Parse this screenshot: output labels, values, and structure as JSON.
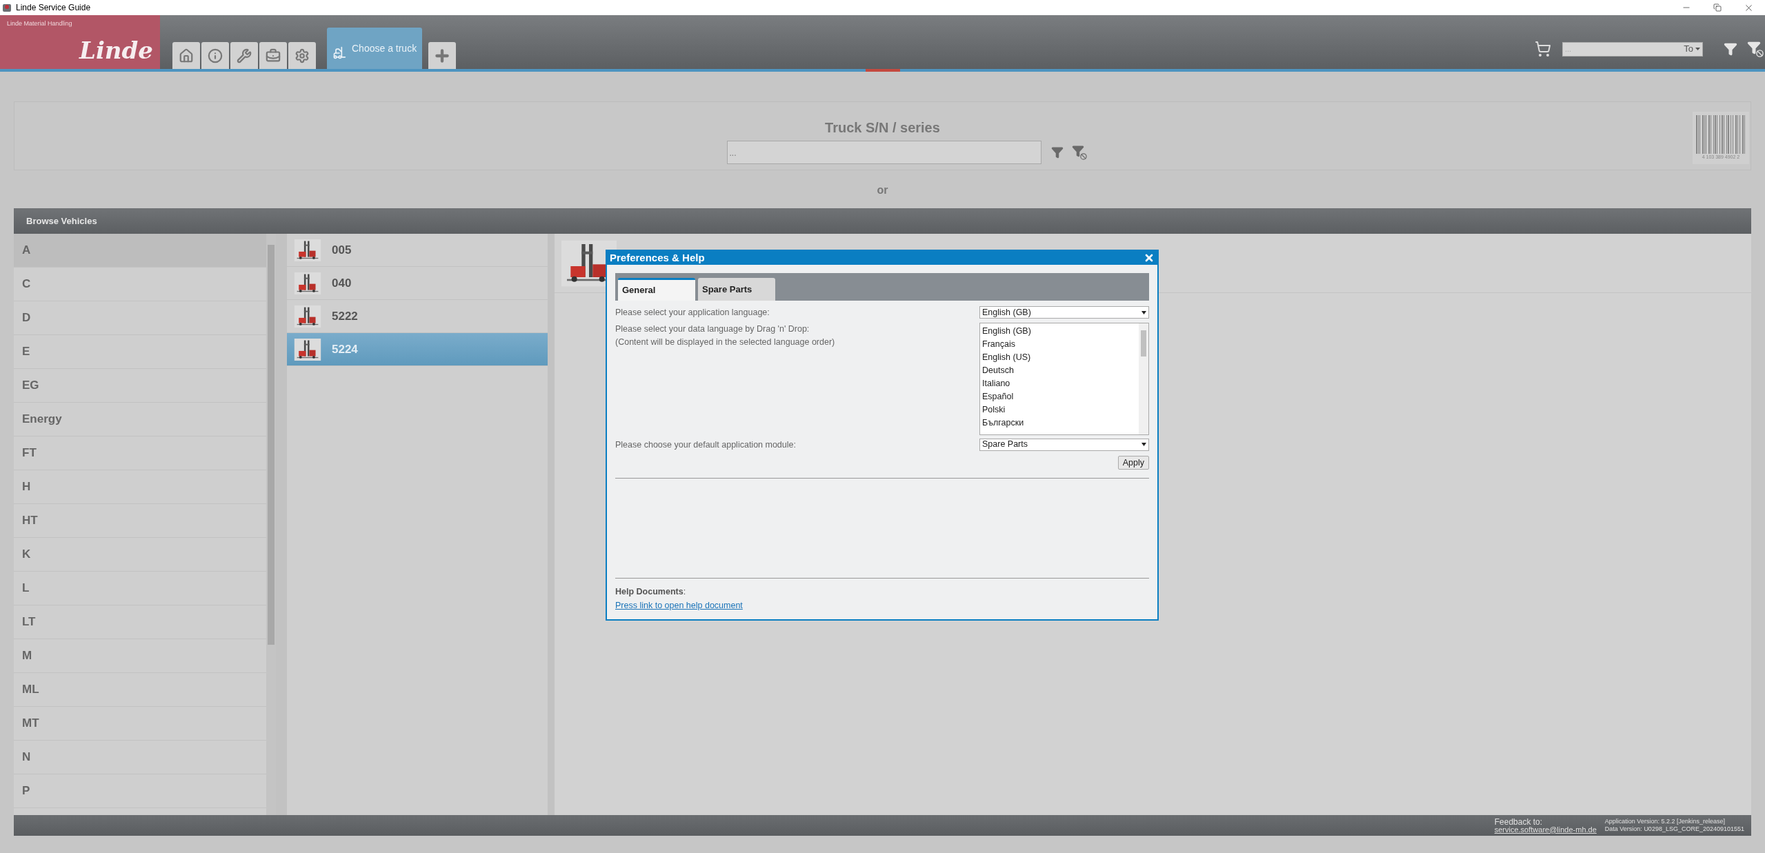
{
  "window": {
    "title": "Linde Service Guide"
  },
  "header": {
    "brand": "Linde Material Handling",
    "logo": "Linde",
    "tabs": [
      {
        "label": "Choose a truck",
        "selected": true
      }
    ],
    "search": {
      "placeholder": "...",
      "dropdown": "To"
    }
  },
  "search": {
    "title": "Truck S/N / series",
    "placeholder": "...",
    "barcode_digits": "4 103 389 4902 2"
  },
  "or_label": "or",
  "browse": {
    "title": "Browse Vehicles",
    "groups": [
      {
        "label": "A",
        "selected": true
      },
      {
        "label": "C",
        "selected": false
      },
      {
        "label": "D",
        "selected": false
      },
      {
        "label": "E",
        "selected": false
      },
      {
        "label": "EG",
        "selected": false
      },
      {
        "label": "Energy",
        "selected": false
      },
      {
        "label": "FT",
        "selected": false
      },
      {
        "label": "H",
        "selected": false
      },
      {
        "label": "HT",
        "selected": false
      },
      {
        "label": "K",
        "selected": false
      },
      {
        "label": "L",
        "selected": false
      },
      {
        "label": "LT",
        "selected": false
      },
      {
        "label": "M",
        "selected": false
      },
      {
        "label": "ML",
        "selected": false
      },
      {
        "label": "MT",
        "selected": false
      },
      {
        "label": "N",
        "selected": false
      },
      {
        "label": "P",
        "selected": false
      }
    ],
    "series": [
      {
        "label": "005",
        "selected": false
      },
      {
        "label": "040",
        "selected": false
      },
      {
        "label": "5222",
        "selected": false
      },
      {
        "label": "5224",
        "selected": true
      }
    ]
  },
  "dialog": {
    "title": "Preferences & Help",
    "tabs": [
      {
        "label": "General",
        "selected": true
      },
      {
        "label": "Spare Parts",
        "selected": false
      }
    ],
    "app_language": {
      "label": "Please select your application language:",
      "value": "English (GB)"
    },
    "data_language": {
      "label": "Please select your data language by Drag 'n' Drop:",
      "note": "(Content will be displayed in the selected language order)",
      "options": [
        "English (GB)",
        "Français",
        "English (US)",
        "Deutsch",
        "Italiano",
        "Español",
        "Polski",
        "Български"
      ]
    },
    "module": {
      "label": "Please choose your default application module:",
      "value": "Spare Parts"
    },
    "apply": "Apply",
    "help": {
      "heading": "**Help Documents**:",
      "link": "Press link to open help document"
    }
  },
  "footer": {
    "feedback_label": "Feedback to:",
    "email": "service.software@linde-mh.de",
    "app_version": "Application Version: 5.2.2 [Jenkins_release]",
    "data_version": "Data Version: U0298_LSG_CORE_202409101551"
  }
}
